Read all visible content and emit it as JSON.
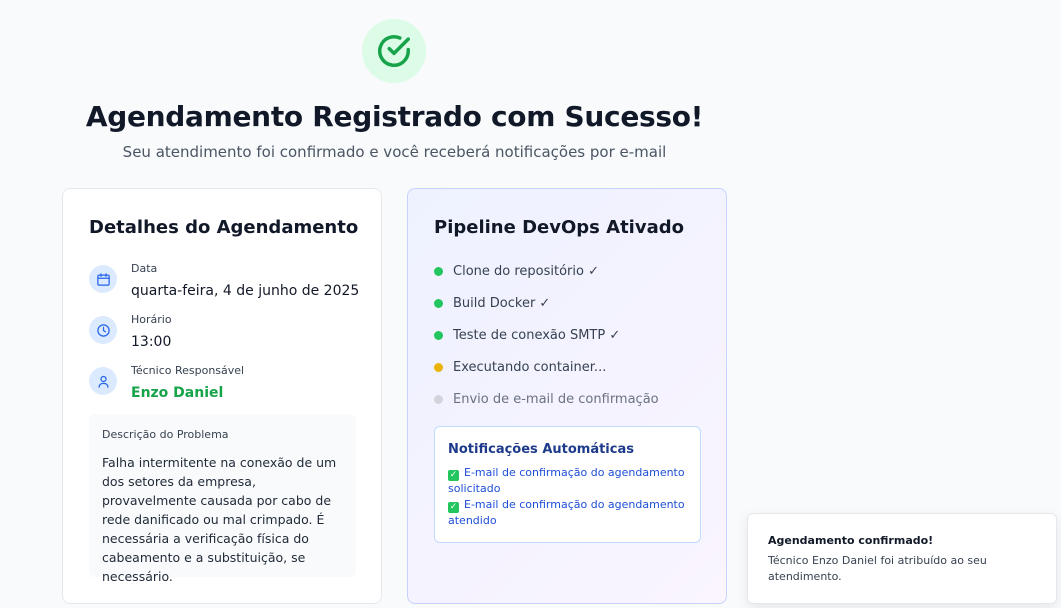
{
  "header": {
    "title": "Agendamento Registrado com Sucesso!",
    "subtitle": "Seu atendimento foi confirmado e você receberá notificações por e-mail"
  },
  "details": {
    "title": "Detalhes do Agendamento",
    "date_label": "Data",
    "date_value": "quarta-feira, 4 de junho de 2025",
    "time_label": "Horário",
    "time_value": "13:00",
    "tech_label": "Técnico Responsável",
    "tech_value": "Enzo Daniel",
    "description_label": "Descrição do Problema",
    "description_text": "Falha intermitente na conexão de um dos setores da empresa, provavelmente causada por cabo de rede danificado ou mal crimpado. É necessária a verificação física do cabeamento e a substituição, se necessário."
  },
  "pipeline": {
    "title": "Pipeline DevOps Ativado",
    "steps": [
      {
        "label": "Clone do repositório ✓",
        "status": "done"
      },
      {
        "label": "Build Docker ✓",
        "status": "done"
      },
      {
        "label": "Teste de conexão SMTP ✓",
        "status": "done"
      },
      {
        "label": "Executando container...",
        "status": "running"
      },
      {
        "label": "Envio de e-mail de confirmação",
        "status": "pending"
      }
    ],
    "notifications": {
      "title": "Notificações Automáticas",
      "items": [
        "E-mail de confirmação do agendamento solicitado",
        "E-mail de confirmação do agendamento atendido"
      ]
    }
  },
  "toast": {
    "title": "Agendamento confirmado!",
    "text": "Técnico Enzo Daniel foi atribuído ao seu atendimento."
  },
  "icons": {
    "success": "check-circle-icon",
    "date": "calendar-icon",
    "time": "clock-icon",
    "tech": "user-icon",
    "notification_check": "checkmark-box-icon"
  },
  "colors": {
    "success": "#16a34a",
    "success_bg": "#dcfce7",
    "running": "#eab308",
    "pending": "#d1d5db",
    "accent_blue": "#1d4ed8"
  }
}
